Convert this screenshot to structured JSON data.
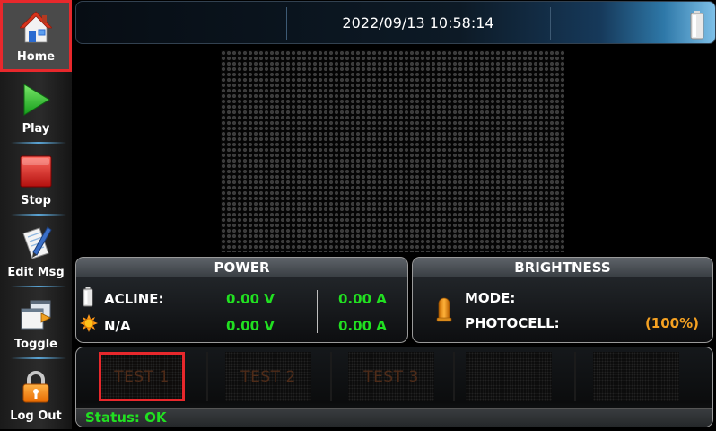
{
  "sidebar": {
    "items": [
      {
        "label": "Home",
        "icon": "home-icon",
        "active": true
      },
      {
        "label": "Play",
        "icon": "play-icon"
      },
      {
        "label": "Stop",
        "icon": "stop-icon"
      },
      {
        "label": "Edit Msg",
        "icon": "edit-message-icon"
      },
      {
        "label": "Toggle",
        "icon": "toggle-windows-icon"
      },
      {
        "label": "Log Out",
        "icon": "lock-icon"
      }
    ]
  },
  "header": {
    "datetime": "2022/09/13 10:58:14",
    "battery_icon": "battery-icon"
  },
  "display": {
    "matrix_name": "led-matrix-preview"
  },
  "power": {
    "title": "POWER",
    "rows": [
      {
        "icon": "battery-small-icon",
        "label": "ACLINE:",
        "voltage": "0.00 V",
        "current": "0.00 A"
      },
      {
        "icon": "sun-icon",
        "label": "N/A",
        "voltage": "0.00 V",
        "current": "0.00 A"
      }
    ]
  },
  "brightness": {
    "title": "BRIGHTNESS",
    "icon": "photocell-bulb-icon",
    "mode_label": "MODE:",
    "mode_value": "",
    "photocell_label": "PHOTOCELL:",
    "photocell_value": "(100%)"
  },
  "messages": {
    "slots": [
      "TEST 1",
      "TEST 2",
      "TEST 3",
      "",
      ""
    ],
    "selected": 0
  },
  "status": {
    "text": "Status: OK"
  },
  "colors": {
    "accent_red": "#e8282c",
    "value_green": "#21e021",
    "value_orange": "#f5a122",
    "header_blue": "#2e78a8"
  }
}
